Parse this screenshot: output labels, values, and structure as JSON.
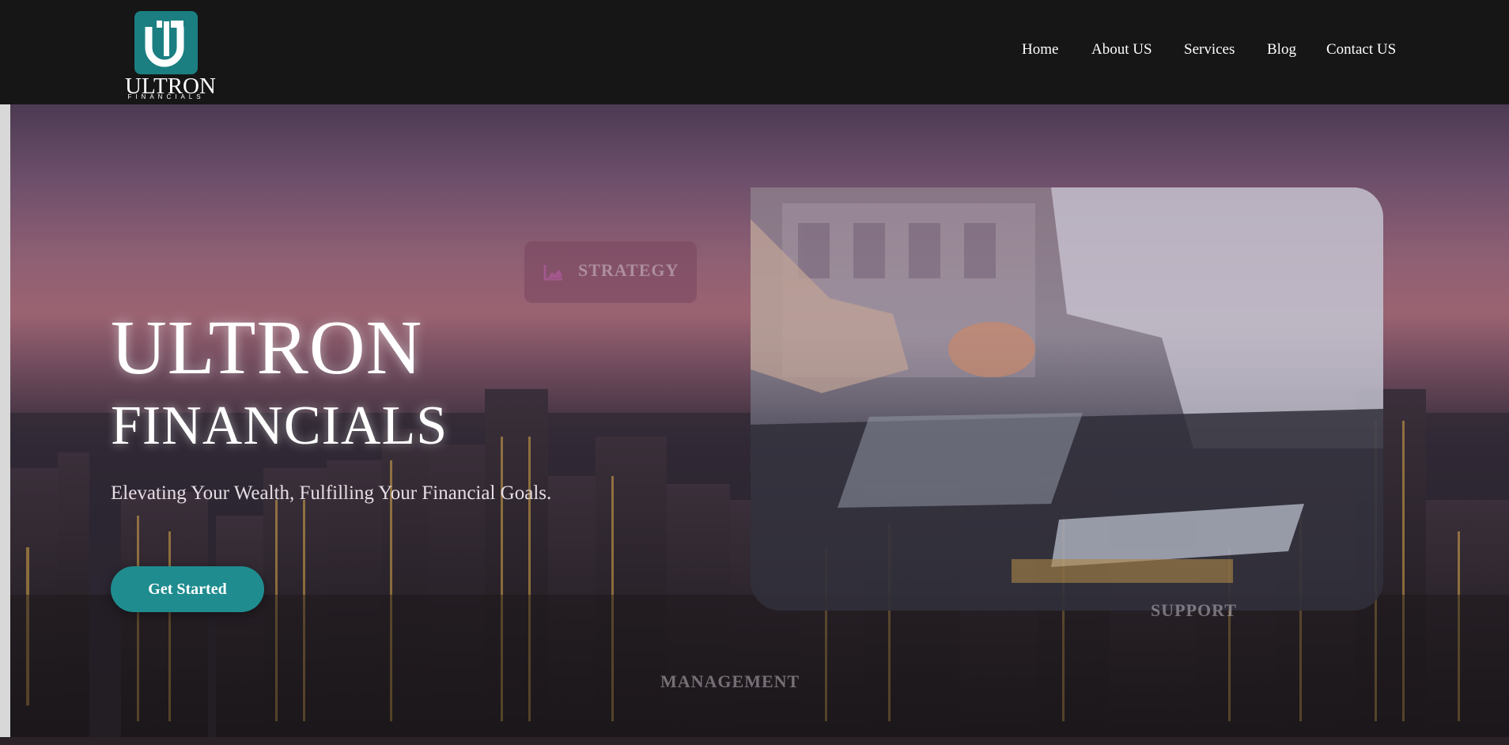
{
  "brand": {
    "name": "ULTRON",
    "sub": "FINANCIALS"
  },
  "nav": {
    "items": [
      {
        "label": "Home"
      },
      {
        "label": "About US"
      },
      {
        "label": "Services"
      },
      {
        "label": "Blog"
      },
      {
        "label": "Contact US"
      }
    ]
  },
  "hero": {
    "title_line1": "ULTRON",
    "title_line2": "FINANCIALS",
    "tagline": "Elevating Your Wealth, Fulfilling Your Financial Goals.",
    "cta_label": "Get Started"
  },
  "chips": {
    "strategy": "STRATEGY",
    "support": "SUPPORT",
    "management": "MANAGEMENT"
  },
  "colors": {
    "accent": "#1f8c8f",
    "header_bg": "#161616"
  }
}
